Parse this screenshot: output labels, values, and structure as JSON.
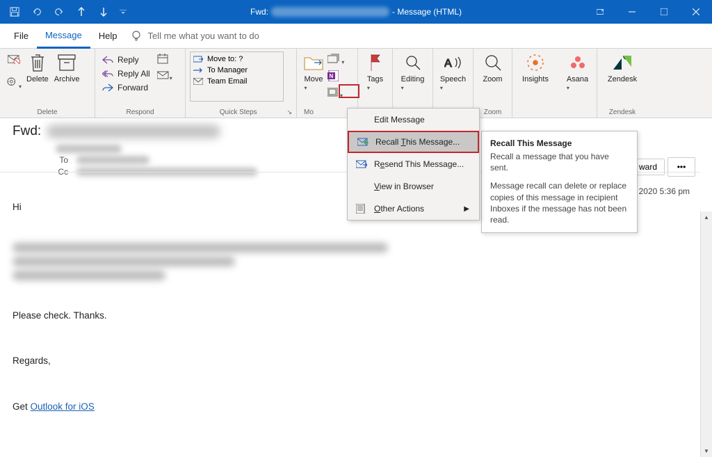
{
  "title": {
    "suffix": "- Message (HTML)",
    "prefix": "Fwd:"
  },
  "tabs": {
    "file": "File",
    "message": "Message",
    "help": "Help",
    "search": "Tell me what you want to do"
  },
  "ribbon": {
    "delete": {
      "label": "Delete",
      "archive": "Archive",
      "group": "Delete"
    },
    "respond": {
      "reply": "Reply",
      "reply_all": "Reply All",
      "forward": "Forward",
      "group": "Respond"
    },
    "quicksteps": {
      "move_to": "Move to: ?",
      "to_manager": "To Manager",
      "team_email": "Team Email",
      "group": "Quick Steps"
    },
    "move": {
      "label": "Move",
      "group": "Move"
    },
    "onenote_tooltip": "OneNote",
    "tags": {
      "label": "Tags"
    },
    "editing": {
      "label": "Editing"
    },
    "speech": {
      "label": "Speech"
    },
    "zoom": {
      "label": "Zoom",
      "group": "Zoom"
    },
    "insights": {
      "label": "Insights"
    },
    "asana": {
      "label": "Asana"
    },
    "zendesk": {
      "label": "Zendesk",
      "group": "Zendesk"
    }
  },
  "subject": {
    "label": "Fwd:"
  },
  "meta": {
    "to": "To",
    "cc": "Cc"
  },
  "header_actions": {
    "forward": "ward"
  },
  "datetime": "2020 5:36 pm",
  "body": {
    "greeting": "Hi",
    "check": "Please check. Thanks.",
    "regards": "Regards,",
    "get": "Get ",
    "link": "Outlook for iOS"
  },
  "menu": {
    "edit": "Edit Message",
    "recall_pre": "Recall ",
    "recall_u": "T",
    "recall_post": "his Message...",
    "resend_pre": "R",
    "resend_u": "e",
    "resend_post": "send This Message...",
    "view_pre": "",
    "view_u": "V",
    "view_post": "iew in Browser",
    "other_pre": "",
    "other_u": "O",
    "other_post": "ther Actions"
  },
  "tooltip": {
    "title": "Recall This Message",
    "p1": "Recall a message that you have sent.",
    "p2": "Message recall can delete or replace copies of this message in recipient Inboxes if the message has not been read."
  }
}
